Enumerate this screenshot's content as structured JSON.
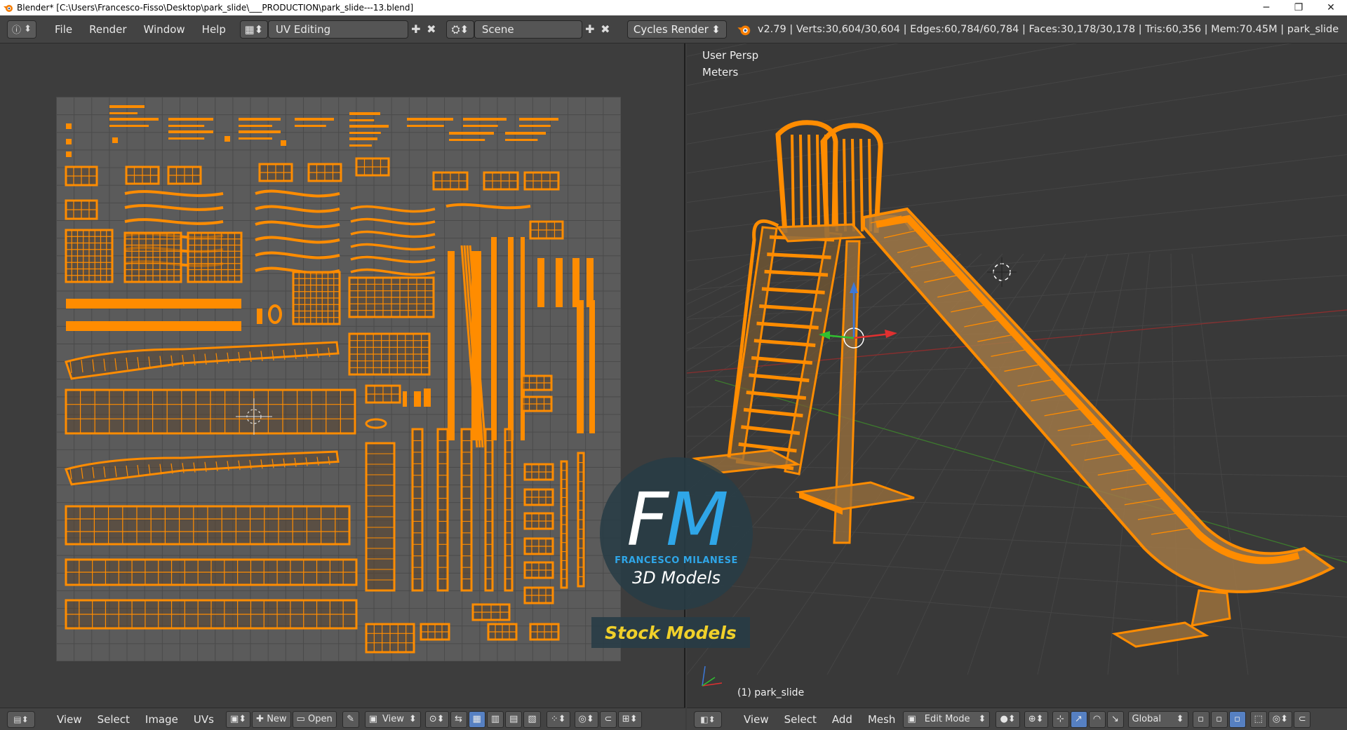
{
  "titlebar": {
    "title": "Blender* [C:\\Users\\Francesco-Fisso\\Desktop\\park_slide\\___PRODUCTION\\park_slide---13.blend]",
    "minimize": "─",
    "maximize": "❐",
    "close": "✕"
  },
  "info": {
    "editor_icon": "ⓘ",
    "menus": [
      "File",
      "Render",
      "Window",
      "Help"
    ],
    "screen_layout": "UV Editing",
    "scene": "Scene",
    "render_engine": "Cycles Render",
    "stats": "v2.79 | Verts:30,604/30,604 | Edges:60,784/60,784 | Faces:30,178/30,178 | Tris:60,356 | Mem:70.45M | park_slide"
  },
  "view3d": {
    "persp_label": "User Persp",
    "units_label": "Meters",
    "object_label": "(1) park_slide"
  },
  "uv_header": {
    "menus": [
      "View",
      "Select",
      "Image",
      "UVs"
    ],
    "new_label": "New",
    "open_label": "Open",
    "view_label": "View"
  },
  "view3d_header": {
    "menus": [
      "View",
      "Select",
      "Add",
      "Mesh"
    ],
    "mode": "Edit Mode",
    "orientation": "Global"
  },
  "watermark": {
    "fm_f": "F",
    "fm_m": "M",
    "name": "FRANCESCO MILANESE",
    "sub": "3D Models",
    "stock": "Stock Models"
  },
  "colors": {
    "accent": "#ff8c00",
    "background": "#3d3d3d",
    "header": "#434343",
    "active_button": "#5680c2"
  }
}
